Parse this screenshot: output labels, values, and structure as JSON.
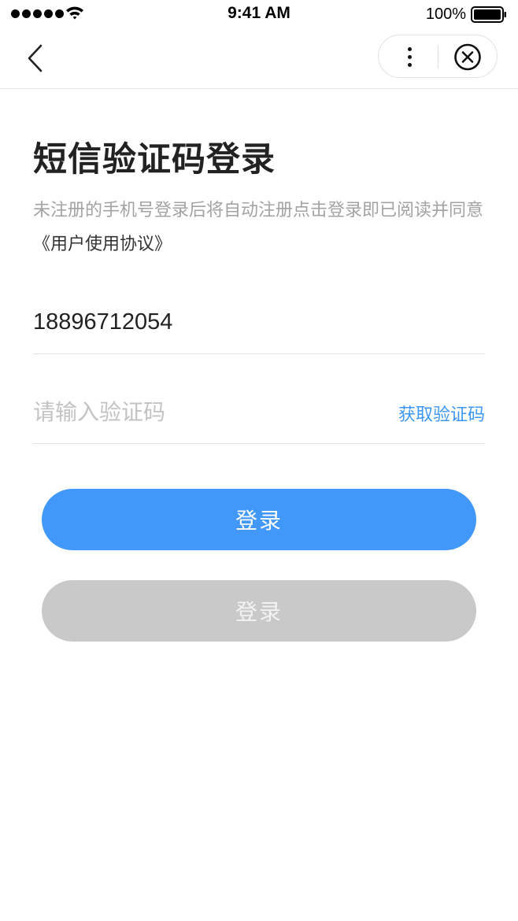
{
  "status_bar": {
    "time": "9:41 AM",
    "battery_percent": "100%",
    "battery_level": 1.0,
    "signal_bars": 5,
    "icons": [
      "signal-dots-icon",
      "wifi-icon",
      "battery-icon"
    ]
  },
  "nav": {
    "back_icon": "chevron-left-icon",
    "more_icon": "more-vertical-icon",
    "close_icon": "close-circle-icon"
  },
  "page": {
    "title": "短信验证码登录",
    "subtitle_text": "未注册的手机号登录后将自动注册点击登录即已阅读并同意",
    "agreement_link": "《用户使用协议》"
  },
  "form": {
    "phone_value": "18896712054",
    "code_value": "",
    "code_placeholder": "请输入验证码",
    "get_code_label": "获取验证码"
  },
  "buttons": {
    "login_label": "登录",
    "login_disabled_label": "登录"
  },
  "colors": {
    "accent": "#4298f9",
    "link": "#3d97f6",
    "disabled": "#c9c9c9"
  }
}
